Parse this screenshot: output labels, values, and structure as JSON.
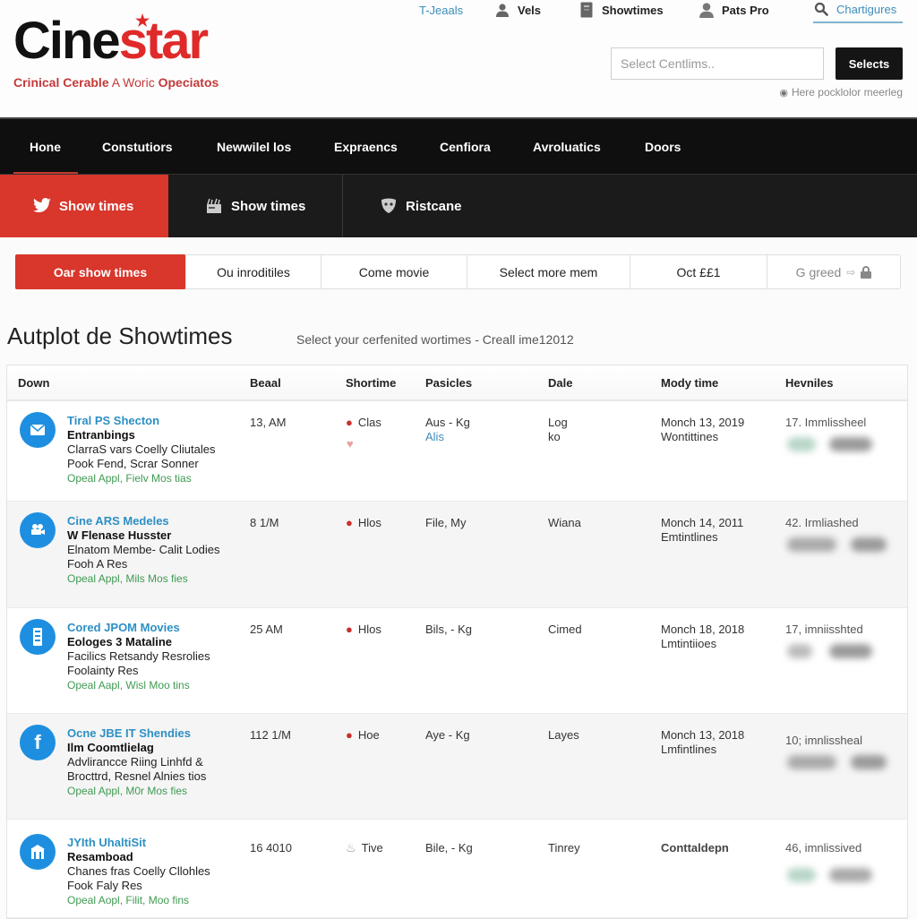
{
  "brand": {
    "name_part1": "Cine",
    "name_part2": "star",
    "tagline_bold1": "Crinical Cerable",
    "tagline_thin": " A Woric ",
    "tagline_bold2": "Opeciatos",
    "accent_color": "#d9362c"
  },
  "topnav": {
    "items": [
      {
        "label": "T-Jeaals",
        "icon": "none"
      },
      {
        "label": "Vels",
        "icon": "user-icon"
      },
      {
        "label": "Showtimes",
        "icon": "document-icon"
      },
      {
        "label": "Pats Pro",
        "icon": "user-icon"
      },
      {
        "label": "Chartigures",
        "icon": "search-icon"
      }
    ]
  },
  "search": {
    "placeholder": "Select Centlims..",
    "button_label": "Selects",
    "hint": "Here pocklolor meerleg"
  },
  "mainnav": {
    "items": [
      "Hone",
      "Constutiors",
      "Newwilel los",
      "Expraencs",
      "Cenfiora",
      "Avroluatics",
      "Doors"
    ],
    "active_index": 0
  },
  "subnav": {
    "items": [
      {
        "label": "Show times",
        "icon": "twitter-bird-icon"
      },
      {
        "label": "Show times",
        "icon": "clapperboard-icon"
      },
      {
        "label": "Ristcane",
        "icon": "mask-icon"
      }
    ],
    "active_index": 0
  },
  "filters": {
    "items": [
      "Oar show times",
      "Ou inroditiles",
      "Come movie",
      "Select more mem",
      "Oct ££1",
      "G greed"
    ],
    "active_index": 0
  },
  "section": {
    "title": "Autplot de Showtimes",
    "subtitle": "Select your cerfenited wortimes - Creall ime12012"
  },
  "table": {
    "headers": [
      "Down",
      "Beaal",
      "Shortime",
      "Pasicles",
      "Dale",
      "Mody time",
      "Hevniles"
    ],
    "rows": [
      {
        "icon": "mail-icon",
        "title": "Tiral PS Shecton",
        "subtitle": "Entranbings",
        "line1": "ClarraS vars Coelly Cliutales",
        "line2": "Pook Fend, Scrar Sonner",
        "meta": "Opeal Appl, Fielv Mos tias",
        "beaal": "13, AM",
        "shortime": "Clas",
        "pasicles": "Aus - Kg",
        "pasicles_link": "Alis",
        "dale": "Log",
        "dale2": "ko",
        "mody": "Monch 13, 2019",
        "mody2": "Wontittines",
        "hevniles": "17. Immlissheel"
      },
      {
        "icon": "film-camera-icon",
        "title": "Cine ARS Medeles",
        "subtitle": "W Flenase Husster",
        "line1": "Elnatom Membe- Calit Lodies",
        "line2": "Fooh A Res",
        "meta": "Opeal Appl, Mils Mos fies",
        "beaal": "8 1/M",
        "shortime": "Hlos",
        "pasicles": "File, My",
        "pasicles_link": "",
        "dale": "Wiana",
        "dale2": "",
        "mody": "Monch 14, 2011",
        "mody2": "Emtintlines",
        "hevniles": "42. Irmliashed"
      },
      {
        "icon": "ticket-icon",
        "title": "Cored JPOM Movies",
        "subtitle": "Eologes 3 Mataline",
        "line1": "Facilics Retsandy Resrolies",
        "line2": "Foolainty Res",
        "meta": "Opeal Aapl, Wisl Moo tins",
        "beaal": "25 AM",
        "shortime": "Hlos",
        "pasicles": "Bils, - Kg",
        "pasicles_link": "",
        "dale": "Cimed",
        "dale2": "",
        "mody": "Monch 18, 2018",
        "mody2": "Lmtintiioes",
        "hevniles": "17, imniisshted"
      },
      {
        "icon": "facebook-icon",
        "title": "Ocne JBE IT Shendies",
        "subtitle": "Ilm Coomtlielag",
        "line1": "Advlirancce Riing Linhfd &",
        "line2": "Brocttrd, Resnel Alnies tios",
        "meta": "Opeal Appl, M0r Mos fies",
        "beaal": "112 1/M",
        "shortime": "Hoe",
        "pasicles": "Aye - Kg",
        "pasicles_link": "",
        "dale": "Layes",
        "dale2": "",
        "mody": "Monch 13, 2018",
        "mody2": "Lmfintlines",
        "hevniles": "10; imnlissheal"
      },
      {
        "icon": "building-icon",
        "title": "JYIth UhaltiSit",
        "subtitle": "Resamboad",
        "line1": "Chanes fras Coelly Cllohles",
        "line2": "Fook Faly Res",
        "meta": "Opeal Aopl, Filit, Moo fins",
        "beaal": "16 4010",
        "shortime": "Tive",
        "pasicles": "Bile, - Kg",
        "pasicles_link": "",
        "dale": "Tinrey",
        "dale2": "",
        "mody": "Conttaldepn",
        "mody2": "",
        "hevniles": "46, imnlissived"
      }
    ]
  }
}
